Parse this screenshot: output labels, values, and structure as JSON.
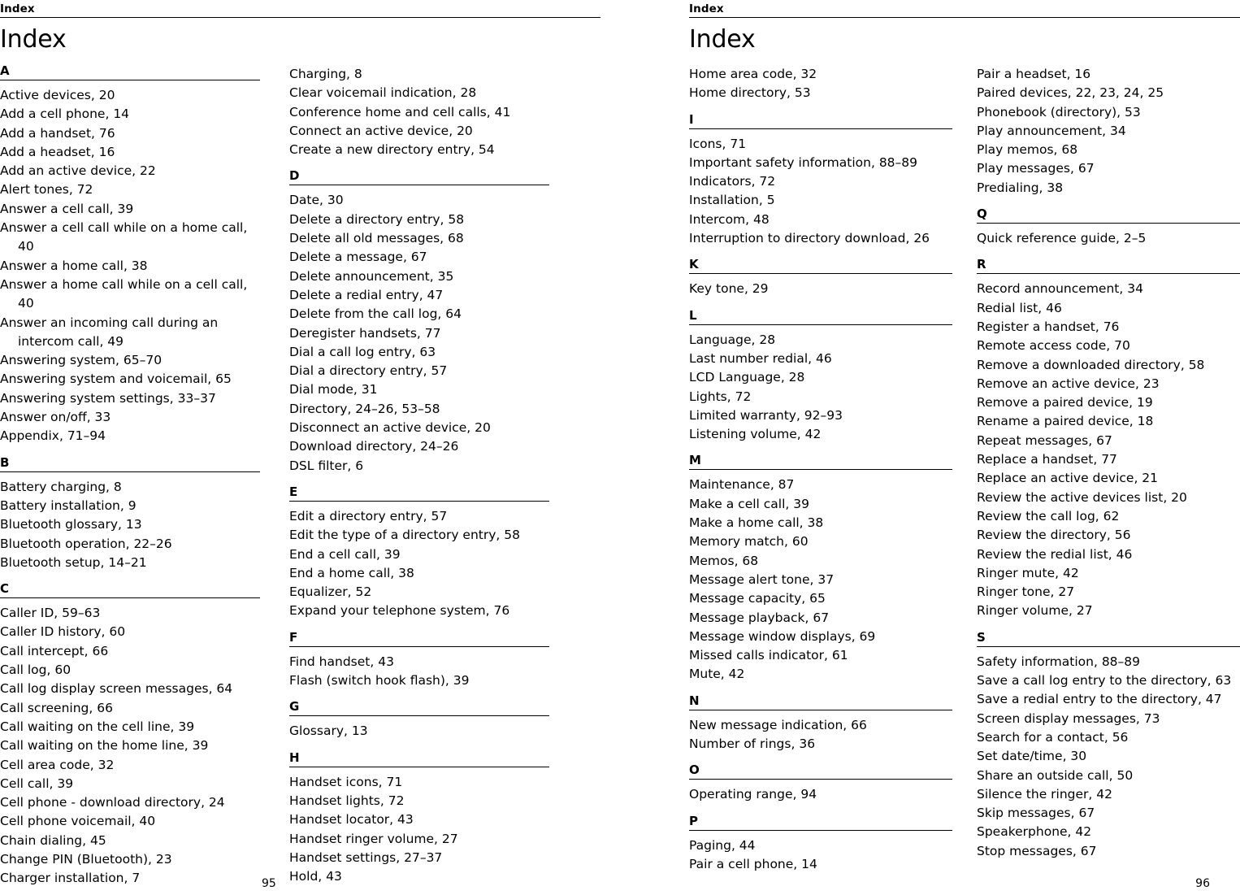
{
  "left_page": {
    "running_head": "Index",
    "title": "Index",
    "folio": "95",
    "columns": [
      {
        "groups": [
          {
            "letter": "A",
            "entries": [
              "Active devices, 20",
              "Add a cell phone, 14",
              "Add a handset, 76",
              "Add a headset, 16",
              "Add an active device, 22",
              "Alert tones, 72",
              "Answer a cell call, 39",
              "Answer a cell call while on a home call, 40",
              "Answer a home call, 38",
              "Answer a home call while on a cell call, 40",
              "Answer an incoming call during an intercom call, 49",
              "Answering system, 65–70",
              "Answering system and voicemail, 65",
              "Answering system settings, 33–37",
              "Answer on/off, 33",
              "Appendix, 71–94"
            ]
          },
          {
            "letter": "B",
            "entries": [
              "Battery charging, 8",
              "Battery installation, 9",
              "Bluetooth glossary, 13",
              "Bluetooth operation, 22–26",
              "Bluetooth setup, 14–21"
            ]
          },
          {
            "letter": "C",
            "entries": [
              "Caller ID, 59–63",
              "Caller ID history, 60",
              "Call intercept, 66",
              "Call log, 60",
              "Call log display screen messages, 64",
              "Call screening, 66",
              "Call waiting on the cell line, 39",
              "Call waiting on the home line, 39",
              "Cell area code, 32",
              "Cell call, 39",
              "Cell phone - download directory, 24",
              "Cell phone voicemail, 40",
              "Chain dialing, 45",
              "Change PIN (Bluetooth), 23",
              "Charger installation, 7"
            ]
          }
        ]
      },
      {
        "groups": [
          {
            "letter": "",
            "entries": [
              "Charging, 8",
              "Clear voicemail indication, 28",
              "Conference home and cell calls, 41",
              "Connect an active device, 20",
              "Create a new directory entry, 54"
            ]
          },
          {
            "letter": "D",
            "entries": [
              "Date, 30",
              "Delete a directory entry, 58",
              "Delete all old messages, 68",
              "Delete a message, 67",
              "Delete announcement, 35",
              "Delete a redial entry, 47",
              "Delete from the call log, 64",
              "Deregister handsets, 77",
              "Dial a call log entry, 63",
              "Dial a directory entry, 57",
              "Dial mode, 31",
              "Directory, 24–26, 53–58",
              "Disconnect an active device, 20",
              "Download directory, 24–26",
              "DSL filter, 6"
            ]
          },
          {
            "letter": "E",
            "entries": [
              "Edit a directory entry, 57",
              "Edit the type of a directory entry, 58",
              "End a cell call, 39",
              "End a home call, 38",
              "Equalizer, 52",
              "Expand your telephone system, 76"
            ]
          },
          {
            "letter": "F",
            "entries": [
              "Find handset, 43",
              "Flash (switch hook flash), 39"
            ]
          },
          {
            "letter": "G",
            "entries": [
              "Glossary, 13"
            ]
          },
          {
            "letter": "H",
            "entries": [
              "Handset icons, 71",
              "Handset lights, 72",
              "Handset locator, 43",
              "Handset ringer volume, 27",
              "Handset settings, 27–37",
              "Hold, 43"
            ]
          }
        ]
      }
    ]
  },
  "right_page": {
    "running_head": "Index",
    "title": "Index",
    "folio": "96",
    "columns": [
      {
        "groups": [
          {
            "letter": "",
            "entries": [
              "Home area code, 32",
              "Home directory, 53"
            ]
          },
          {
            "letter": "I",
            "entries": [
              "Icons, 71",
              "Important safety information, 88–89",
              "Indicators, 72",
              "Installation, 5",
              "Intercom, 48",
              "Interruption to directory download, 26"
            ]
          },
          {
            "letter": "K",
            "entries": [
              "Key tone, 29"
            ]
          },
          {
            "letter": "L",
            "entries": [
              "Language, 28",
              "Last number redial, 46",
              "LCD Language, 28",
              "Lights, 72",
              "Limited warranty, 92–93",
              "Listening volume, 42"
            ]
          },
          {
            "letter": "M",
            "entries": [
              "Maintenance, 87",
              "Make a cell call, 39",
              "Make a home call, 38",
              "Memory match, 60",
              "Memos, 68",
              "Message alert tone, 37",
              "Message capacity, 65",
              "Message playback, 67",
              "Message window displays, 69",
              "Missed calls indicator, 61",
              "Mute, 42"
            ]
          },
          {
            "letter": "N",
            "entries": [
              "New message indication, 66",
              "Number of rings, 36"
            ]
          },
          {
            "letter": "O",
            "entries": [
              "Operating range, 94"
            ]
          },
          {
            "letter": "P",
            "entries": [
              "Paging, 44",
              "Pair a cell phone, 14"
            ]
          }
        ]
      },
      {
        "groups": [
          {
            "letter": "",
            "entries": [
              "Pair a headset, 16",
              "Paired devices, 22, 23, 24, 25",
              "Phonebook (directory), 53",
              "Play announcement, 34",
              "Play memos, 68",
              "Play messages, 67",
              "Predialing, 38"
            ]
          },
          {
            "letter": "Q",
            "entries": [
              "Quick reference guide, 2–5"
            ]
          },
          {
            "letter": "R",
            "entries": [
              "Record announcement, 34",
              "Redial list, 46",
              "Register a handset, 76",
              "Remote access code, 70",
              "Remove a downloaded directory, 58",
              "Remove an active device, 23",
              "Remove a paired device, 19",
              "Rename a paired device, 18",
              "Repeat messages, 67",
              "Replace a handset, 77",
              "Replace an active device, 21",
              "Review the active devices list, 20",
              "Review the call log, 62",
              "Review the directory, 56",
              "Review the redial list, 46",
              "Ringer mute, 42",
              "Ringer tone, 27",
              "Ringer volume, 27"
            ]
          },
          {
            "letter": "S",
            "entries": [
              "Safety information, 88–89",
              "Save a call log entry to the directory, 63",
              "Save a redial entry to the directory, 47",
              "Screen display messages, 73",
              "Search for a contact, 56",
              "Set date/time, 30",
              "Share an outside call, 50",
              "Silence the ringer, 42",
              "Skip messages, 67",
              "Speakerphone, 42",
              "Stop messages, 67"
            ]
          }
        ]
      }
    ]
  }
}
